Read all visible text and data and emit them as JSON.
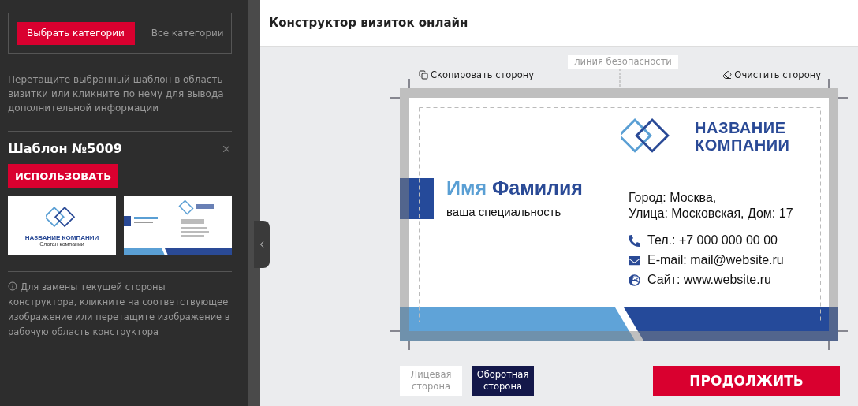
{
  "sidebar": {
    "category_tabs": [
      {
        "label": "Выбрать категории",
        "selected": true
      },
      {
        "label": "Все категории",
        "selected": false
      }
    ],
    "hint": "Перетащите выбранный шаблон в область визитки или кликните по нему для вывода дополнительной информации",
    "template": {
      "title": "Шаблон №5009",
      "use_button": "ИСПОЛЬЗОВАТЬ",
      "thumbnails": [
        {
          "kind": "logo",
          "company": "НАЗВАНИЕ КОМПАНИИ",
          "slogan": "Слоган компании"
        },
        {
          "kind": "card"
        }
      ]
    },
    "info": "Для замены текущей стороны конструктора, кликните на соответствующее изображение или перетащите изображение в рабочую область конструктора"
  },
  "header": {
    "title": "Конструктор визиток онлайн"
  },
  "editor": {
    "copy_side": "Скопировать сторону",
    "safety_line": "линия безопасности",
    "clear_side": "Очистить сторону",
    "card": {
      "company_lines": [
        "НАЗВАНИЕ",
        "КОМПАНИИ"
      ],
      "first_name": "Имя",
      "last_name": "Фамилия",
      "specialty": "ваша специальность",
      "address_lines": [
        "Город: Москва,",
        "Улица: Московская, Дом: 17"
      ],
      "contacts": [
        {
          "kind": "phone",
          "text": "Тел.: +7 000 000 00 00"
        },
        {
          "kind": "email",
          "text": "E-mail: mail@website.ru"
        },
        {
          "kind": "web",
          "text": "Сайт: www.website.ru"
        }
      ]
    }
  },
  "side_tabs": [
    {
      "label": "Лицевая сторона",
      "selected": false
    },
    {
      "label": "Оборотная сторона",
      "selected": true
    }
  ],
  "continue_button": "ПРОДОЛЖИТЬ"
}
